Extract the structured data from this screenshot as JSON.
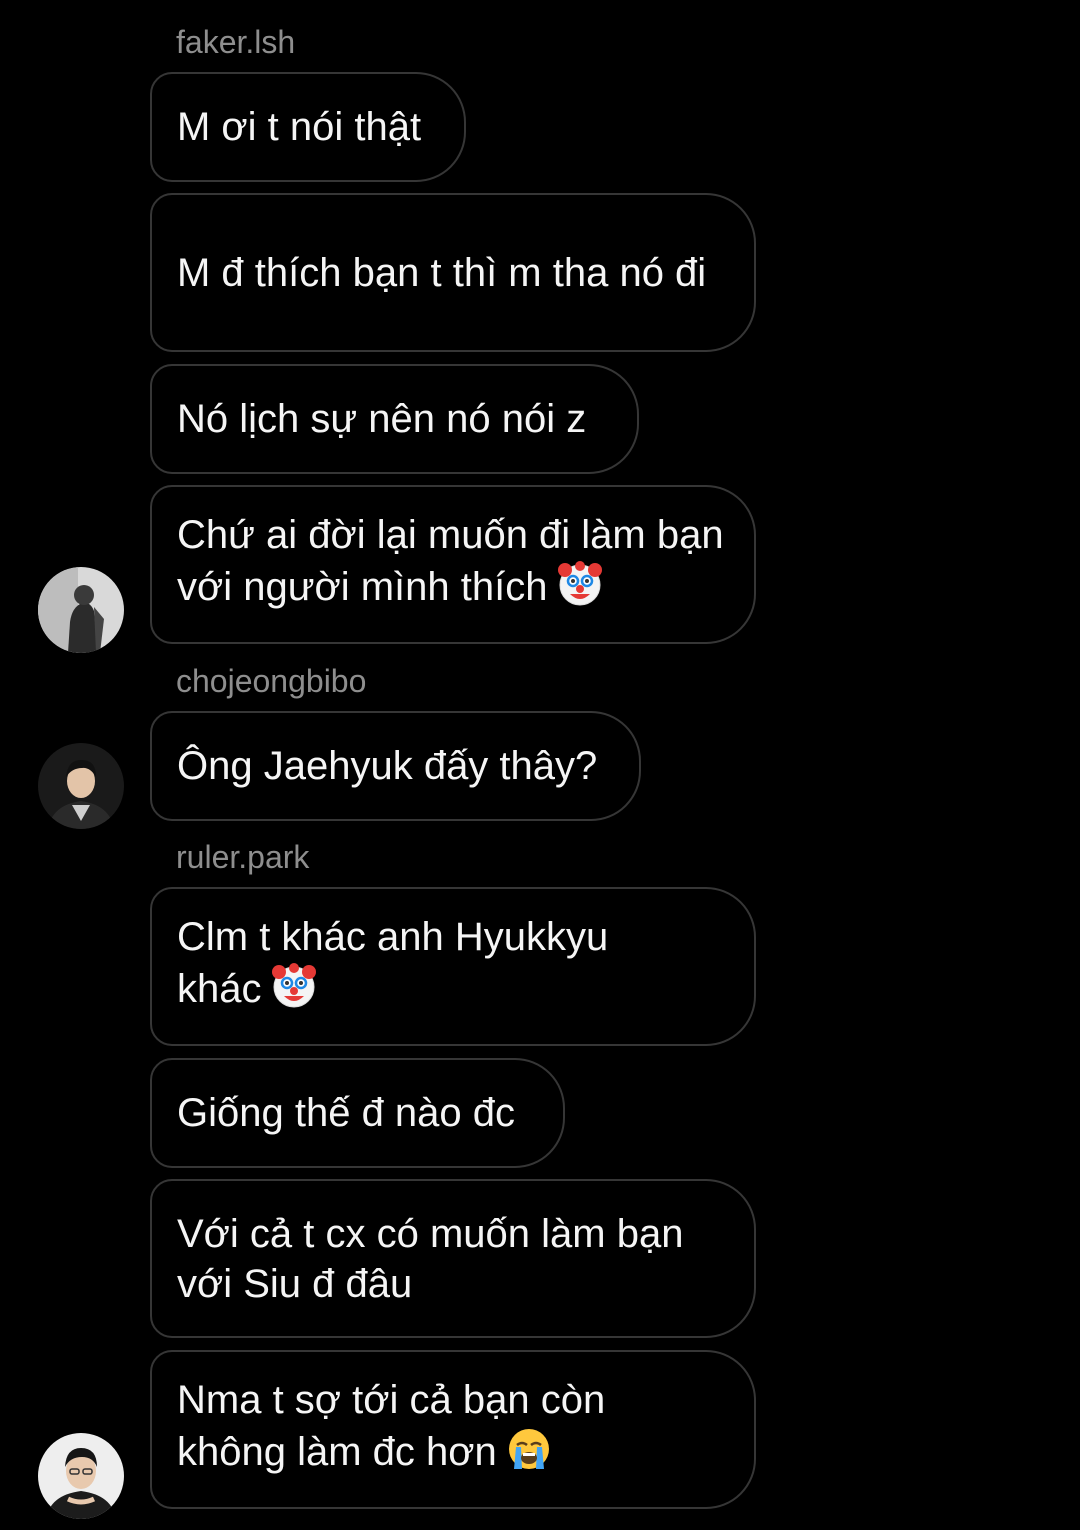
{
  "messages": [
    {
      "type": "username",
      "text": "faker.lsh"
    },
    {
      "type": "bubble",
      "text": "M ơi t nói thật"
    },
    {
      "type": "bubble",
      "text": "M đ thích bạn t thì m tha nó đi"
    },
    {
      "type": "bubble",
      "text": "Nó lịch sự nên nó nói z"
    },
    {
      "type": "bubble",
      "text": "Chứ ai đời lại muốn đi làm bạn với người mình thích",
      "emoji": "clown-face"
    },
    {
      "type": "username",
      "text": "chojeongbibo"
    },
    {
      "type": "bubble",
      "text": "Ông Jaehyuk đấy thây?"
    },
    {
      "type": "username",
      "text": "ruler.park"
    },
    {
      "type": "bubble",
      "text": "Clm t khác anh Hyukkyu khác",
      "emoji": "clown-face"
    },
    {
      "type": "bubble",
      "text": "Giống thế đ nào đc"
    },
    {
      "type": "bubble",
      "text": "Với cả t cx có muốn làm bạn với Siu đ đâu"
    },
    {
      "type": "bubble",
      "text": "Nma t sợ tới cả bạn còn không làm đc hơn",
      "emoji": "loudly-crying-face"
    }
  ],
  "avatars": [
    {
      "name": "faker.lsh",
      "icon": "profile-photo"
    },
    {
      "name": "chojeongbibo",
      "icon": "profile-photo"
    },
    {
      "name": "ruler.park",
      "icon": "profile-photo"
    }
  ],
  "colors": {
    "background": "#000000",
    "bubble_border": "#363636",
    "text": "#f5f5f5",
    "username": "#8e8e8e"
  }
}
